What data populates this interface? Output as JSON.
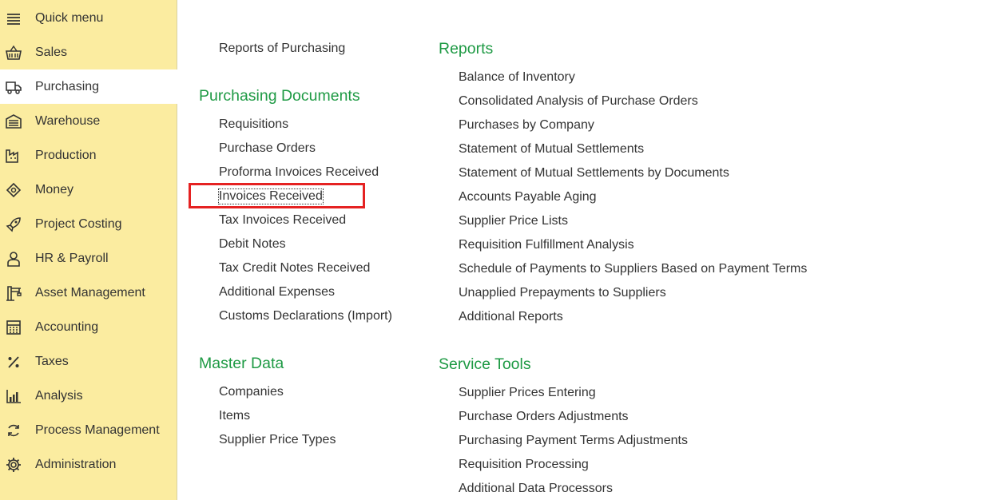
{
  "sidebar": {
    "items": [
      {
        "label": "Quick menu",
        "icon": "menu-icon"
      },
      {
        "label": "Sales",
        "icon": "basket-icon"
      },
      {
        "label": "Purchasing",
        "icon": "truck-icon",
        "active": true
      },
      {
        "label": "Warehouse",
        "icon": "warehouse-icon"
      },
      {
        "label": "Production",
        "icon": "factory-icon"
      },
      {
        "label": "Money",
        "icon": "money-icon"
      },
      {
        "label": "Project Costing",
        "icon": "rocket-icon"
      },
      {
        "label": "HR & Payroll",
        "icon": "person-icon"
      },
      {
        "label": "Asset Management",
        "icon": "crane-icon"
      },
      {
        "label": "Accounting",
        "icon": "calculator-icon"
      },
      {
        "label": "Taxes",
        "icon": "percent-icon"
      },
      {
        "label": "Analysis",
        "icon": "bar-chart-icon"
      },
      {
        "label": "Process Management",
        "icon": "cycle-icon"
      },
      {
        "label": "Administration",
        "icon": "gear-icon"
      }
    ]
  },
  "main": {
    "reports_of_purchasing": "Reports of Purchasing",
    "purchasing_documents": {
      "title": "Purchasing Documents",
      "items": [
        "Requisitions",
        "Purchase Orders",
        "Proforma Invoices Received",
        "Invoices Received",
        "Tax Invoices Received",
        "Debit Notes",
        "Tax Credit Notes Received",
        "Additional Expenses",
        "Customs Declarations (Import)"
      ]
    },
    "master_data": {
      "title": "Master Data",
      "items": [
        "Companies",
        "Items",
        "Supplier Price Types"
      ]
    },
    "reports": {
      "title": "Reports",
      "items": [
        "Balance of Inventory",
        "Consolidated Analysis of Purchase Orders",
        "Purchases by Company",
        "Statement of Mutual Settlements",
        "Statement of Mutual Settlements by Documents",
        "Accounts Payable Aging",
        "Supplier Price Lists",
        "Requisition Fulfillment Analysis",
        "Schedule of Payments to Suppliers Based on Payment Terms",
        "Unapplied Prepayments to Suppliers",
        "Additional Reports"
      ]
    },
    "service_tools": {
      "title": "Service Tools",
      "items": [
        "Supplier Prices Entering",
        "Purchase Orders Adjustments",
        "Purchasing Payment Terms Adjustments",
        "Requisition Processing",
        "Additional Data Processors"
      ]
    }
  },
  "colors": {
    "sidebar_bg": "#fbeca0",
    "group_title": "#1e9a44",
    "highlight": "#e52222"
  }
}
